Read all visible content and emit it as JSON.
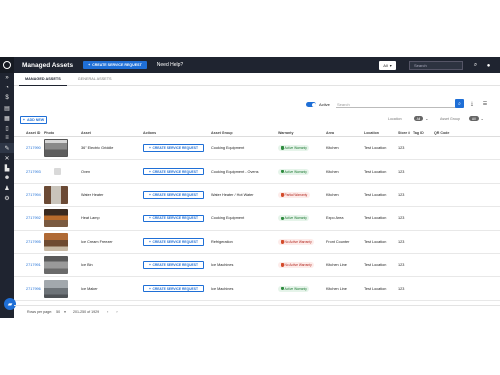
{
  "header": {
    "title": "Managed Assets",
    "create_btn": "CREATE SERVICE REQUEST",
    "help": "Need Help?",
    "scope_select": "All",
    "search_placeholder": "Search"
  },
  "tabs": [
    {
      "label": "MANAGED ASSETS",
      "active": true
    },
    {
      "label": "GENERAL ASSETS",
      "active": false
    }
  ],
  "filters": {
    "active_label": "Active",
    "search_placeholder": "Search",
    "add_new": "ADD NEW",
    "location_label": "Location",
    "location_value": "All",
    "asset_group_label": "Asset Group",
    "asset_group_value": "All"
  },
  "table": {
    "headers": [
      "Asset ID",
      "Photo",
      "Asset",
      "Actions",
      "Asset Group",
      "Warranty",
      "Area",
      "Location",
      "Store #",
      "Tag ID",
      "QR Code"
    ],
    "action_label": "CREATE SERVICE REQUEST",
    "rows": [
      {
        "id": "2717990",
        "asset": "36\" Electric Griddle",
        "group": "Cooking Equipment",
        "warranty": "Active Warranty",
        "warranty_type": "active",
        "area": "Kitchen",
        "location": "Test Location",
        "store": "123",
        "photo": "griddle"
      },
      {
        "id": "2717993",
        "asset": "Oven",
        "group": "Cooking Equipment - Ovens",
        "warranty": "Active Warranty",
        "warranty_type": "active",
        "area": "Kitchen",
        "location": "Test Location",
        "store": "123",
        "photo": "none"
      },
      {
        "id": "2717994",
        "asset": "Water Heater",
        "group": "Water Heater / Hot Water",
        "warranty": "Partial Warranty",
        "warranty_type": "partial",
        "area": "Kitchen",
        "location": "Test Location",
        "store": "123",
        "photo": "heater"
      },
      {
        "id": "2717992",
        "asset": "Heat Lamp",
        "group": "Cooking Equipment",
        "warranty": "Active Warranty",
        "warranty_type": "active",
        "area": "Expo Area",
        "location": "Test Location",
        "store": "123",
        "photo": "lamp"
      },
      {
        "id": "2717995",
        "asset": "Ice Cream Freezer",
        "group": "Refrigeration",
        "warranty": "No Active Warranty",
        "warranty_type": "none",
        "area": "Front Counter",
        "location": "Test Location",
        "store": "123",
        "photo": "freezer"
      },
      {
        "id": "2717991",
        "asset": "Ice Bin",
        "group": "Ice Machines",
        "warranty": "No Active Warranty",
        "warranty_type": "none",
        "area": "Kitchen Line",
        "location": "Test Location",
        "store": "123",
        "photo": "icebin"
      },
      {
        "id": "2717996",
        "asset": "Ice Maker",
        "group": "Ice Machines",
        "warranty": "Active Warranty",
        "warranty_type": "active",
        "area": "Kitchen Line",
        "location": "Test Location",
        "store": "123",
        "photo": "icemaker"
      }
    ]
  },
  "footer": {
    "rows_label": "Rows per page:",
    "rows_value": "50",
    "range": "201-250 of 1929"
  },
  "colors": {
    "accent": "#1f6fd6",
    "header_bg": "#1f2430"
  }
}
